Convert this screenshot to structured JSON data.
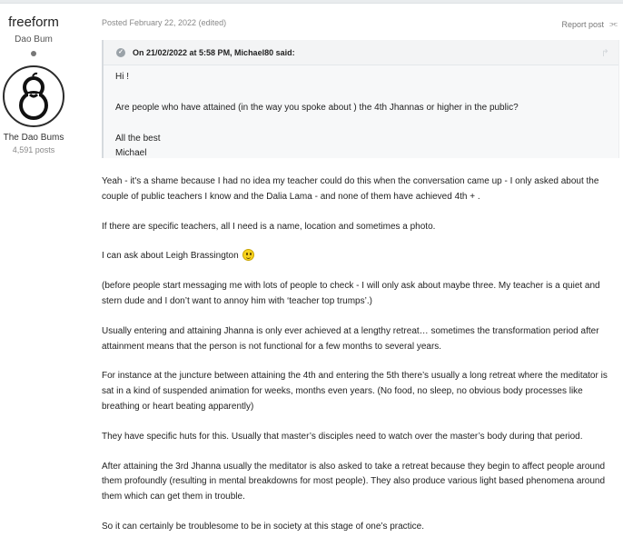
{
  "author": {
    "name": "freeform",
    "rank": "Dao Bum",
    "group": "The Dao Bums",
    "posts": "4,591 posts"
  },
  "post": {
    "meta": "Posted February 22, 2022 (edited)",
    "report_label": "Report post"
  },
  "quote": {
    "header": "On 21/02/2022 at 5:58 PM, Michael80 said:",
    "lines": [
      "Hi !",
      "Are people who have attained (in the way you spoke about  ) the 4th Jhannas or higher in the public?",
      "All the best",
      "Michael"
    ]
  },
  "content": {
    "paragraphs": [
      "Yeah - it's a shame because I had no idea my teacher could do this when the conversation came up - I only asked about the couple of public teachers I know and the Dalia Lama - and none of them have achieved 4th + .",
      "If there are specific teachers, all I need is a name, location and sometimes a photo.",
      "I can ask about Leigh Brassington",
      "(before people start messaging me with lots of people to check - I will only ask about maybe three. My teacher is a quiet and stern dude and I don’t want to annoy him with ‘teacher top trumps’.)",
      "Usually entering and attaining Jhanna is only ever achieved at a lengthy retreat… sometimes the transformation period after attainment means that the person is not functional for a few months to several years.",
      "For instance at the juncture between attaining the 4th and entering the 5th there’s usually a long retreat where the meditator is sat in a kind of suspended animation for weeks, months even years. (No food, no sleep, no obvious body processes like breathing or heart beating apparently)",
      "They have specific huts for this. Usually that master’s disciples need to watch over the master’s body during that period.",
      "After attaining the 3rd Jhanna usually the meditator is also asked to take a retreat because they begin to affect people around them profoundly (resulting in mental breakdowns for most people). They also produce various light based phenomena around them which can get them in trouble.",
      "So it can certainly be troublesome to be in society at this stage of one’s practice."
    ]
  },
  "icons": {
    "share": "share-icon",
    "quote_check": "chevron-check-icon",
    "smiley": "smiley-icon"
  }
}
